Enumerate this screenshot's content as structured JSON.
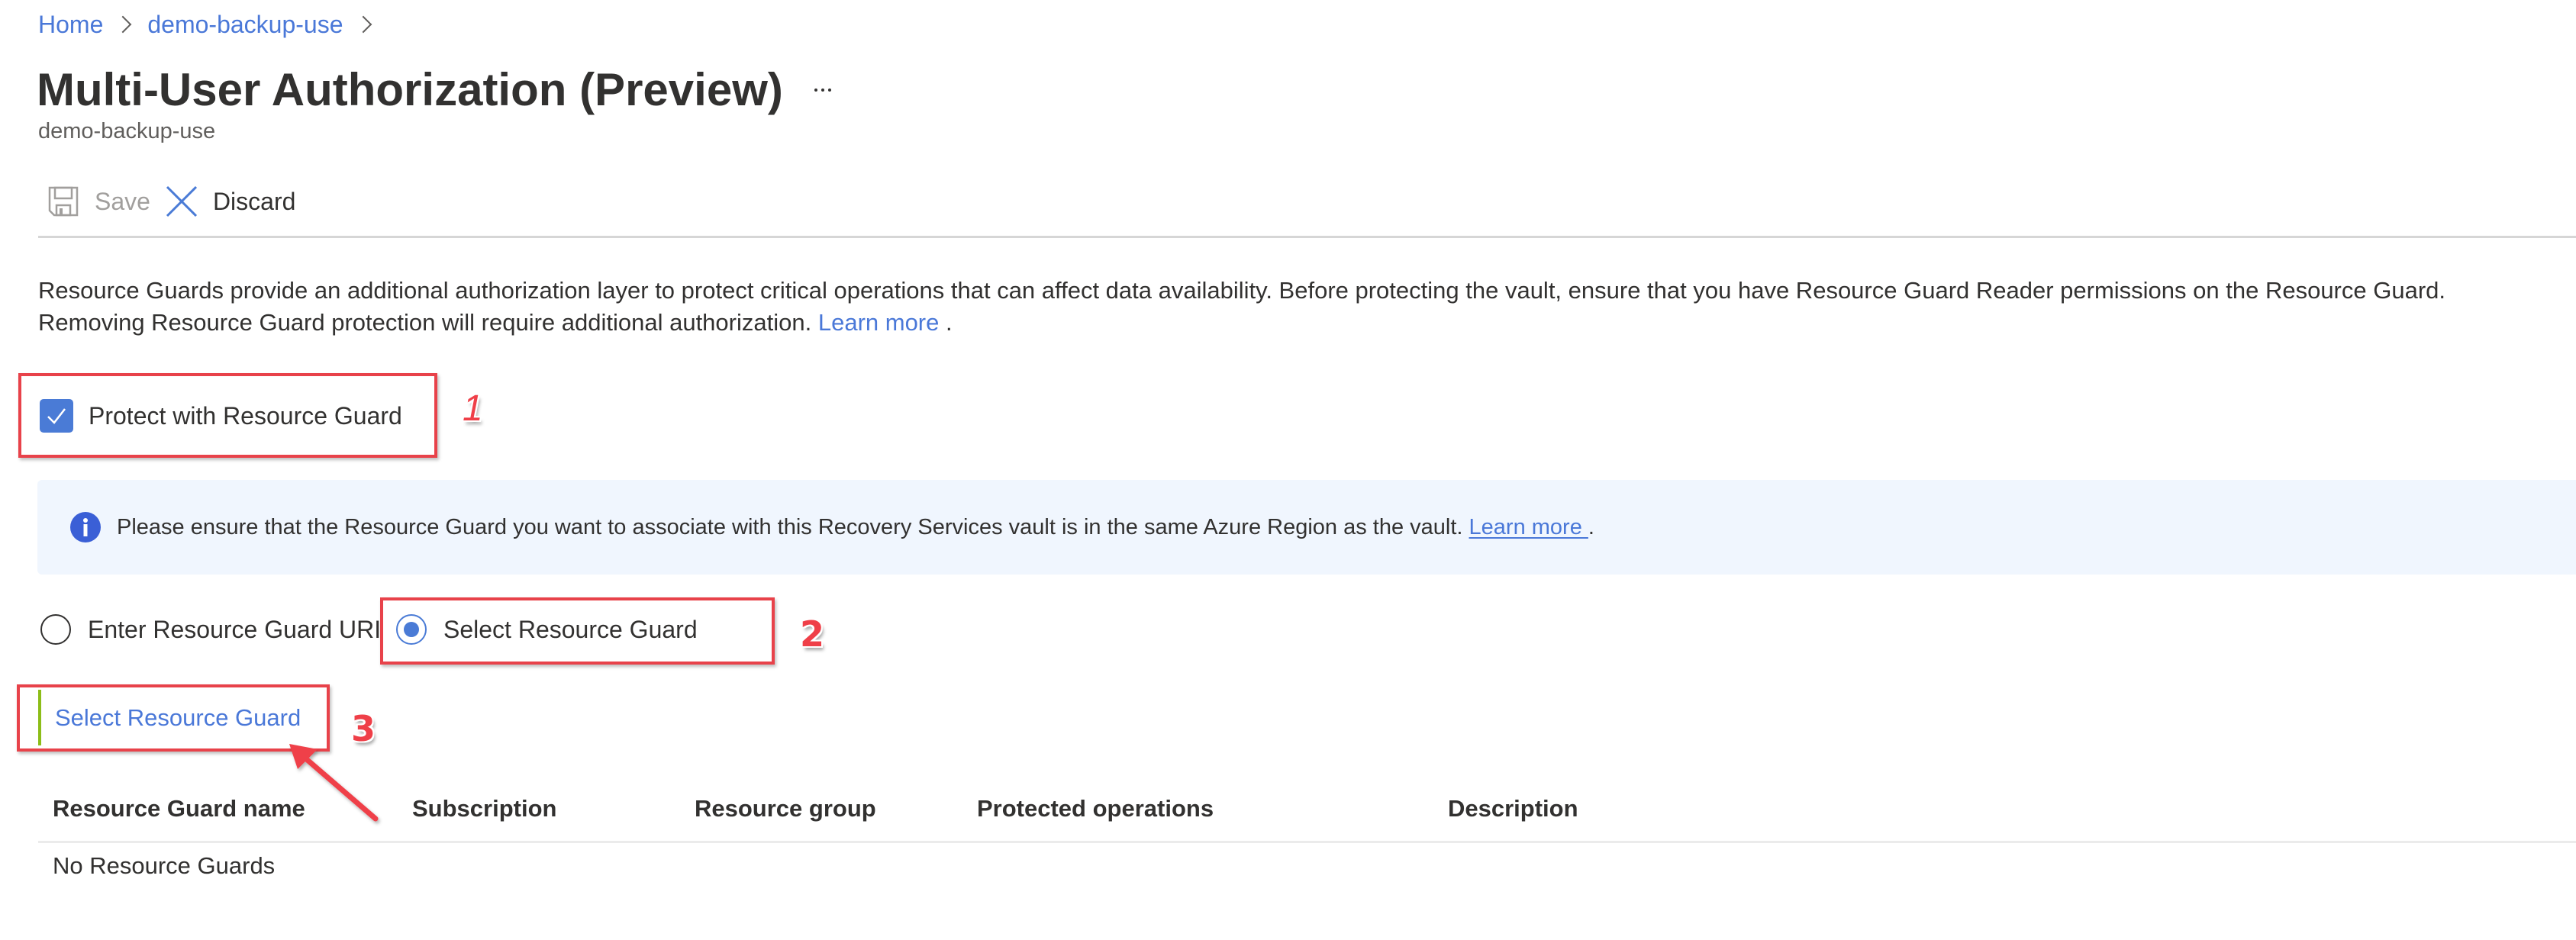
{
  "breadcrumb": {
    "items": [
      {
        "label": "Home"
      },
      {
        "label": "demo-backup-use"
      }
    ]
  },
  "header": {
    "title": "Multi-User Authorization (Preview)",
    "subtitle": "demo-backup-use",
    "more_icon": "ellipsis-icon"
  },
  "toolbar": {
    "save_label": "Save",
    "save_icon": "save-icon",
    "save_enabled": false,
    "discard_label": "Discard",
    "discard_icon": "close-icon"
  },
  "description": {
    "text": "Resource Guards provide an additional authorization layer to protect critical operations that can affect data availability. Before protecting the vault, ensure that you have Resource Guard Reader permissions on the Resource Guard. Removing Resource Guard protection will require additional authorization.",
    "link_label": "Learn more",
    "suffix": " ."
  },
  "protect_checkbox": {
    "label": "Protect with Resource Guard",
    "checked": true
  },
  "info_banner": {
    "icon": "info-icon",
    "text": "Please ensure that the Resource Guard you want to associate with this Recovery Services vault is in the same Azure Region as the vault. ",
    "link_label": "Learn more ",
    "suffix": "."
  },
  "guard_source": {
    "options": [
      {
        "label": "Enter Resource Guard URI",
        "selected": false
      },
      {
        "label": "Select Resource Guard",
        "selected": true
      }
    ]
  },
  "select_link": {
    "label": "Select Resource Guard"
  },
  "table": {
    "columns": [
      "Resource Guard name",
      "Subscription",
      "Resource group",
      "Protected operations",
      "Description"
    ],
    "rows": [],
    "empty_text": "No Resource Guards"
  },
  "annotations": {
    "steps": [
      "1",
      "2",
      "3"
    ]
  },
  "colors": {
    "accent": "#4a7bd6",
    "link": "#4a78d8",
    "annotation_red": "#e8424a",
    "banner_bg": "#f0f6fe",
    "focus_bar": "#8cbd18"
  }
}
